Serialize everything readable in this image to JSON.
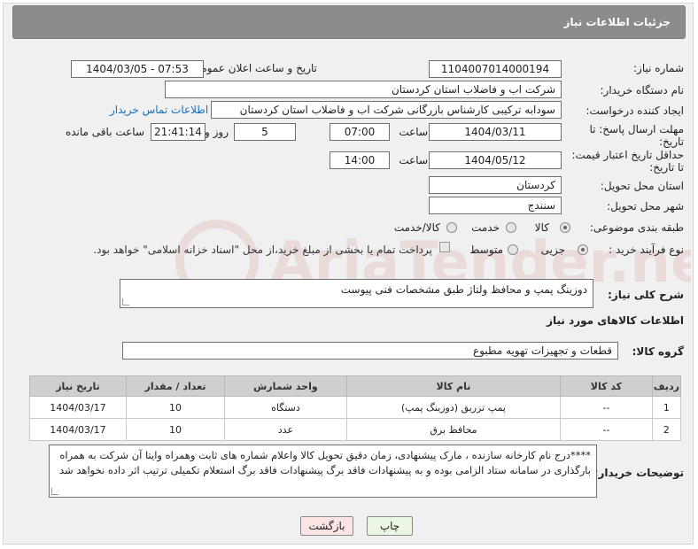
{
  "header": {
    "title": "جزئیات اطلاعات نیاز"
  },
  "form": {
    "need_number_label": "شماره نیاز:",
    "need_number": "1104007014000194",
    "announce_label": "تاریخ و ساعت اعلان عمومی:",
    "announce_value": "1404/03/05 - 07:53",
    "buyer_org_label": "نام دستگاه خریدار:",
    "buyer_org": "شرکت اب و فاضلاب استان کردستان",
    "creator_label": "ایجاد کننده درخواست:",
    "creator": "سودابه ترکیبی کارشناس بازرگانی شرکت اب و فاضلاب استان کردستان",
    "contact_link": "اطلاعات تماس خریدار",
    "reply_deadline_label_1": "مهلت ارسال پاسخ: تا",
    "reply_deadline_label_2": "تاریخ:",
    "reply_date": "1404/03/11",
    "time_label": "ساعت",
    "reply_time": "07:00",
    "days_value": "5",
    "days_label": "روز و",
    "remaining_time": "21:41:14",
    "remaining_label": "ساعت باقی مانده",
    "min_validity_label_1": "حداقل تاریخ اعتبار قیمت:",
    "min_validity_label_2": "تا تاریخ:",
    "validity_date": "1404/05/12",
    "validity_time": "14:00",
    "province_label": "استان محل تحویل:",
    "province": "کردستان",
    "city_label": "شهر محل تحویل:",
    "city": "سنندج",
    "category_label": "طبقه بندی موضوعی:",
    "category_options": [
      "کالا",
      "خدمت",
      "کالا/خدمت"
    ],
    "category_selected": "کالا",
    "process_label": "نوع فرآیند خرید :",
    "process_options": [
      "جزیی",
      "متوسط"
    ],
    "process_selected": "جزیی",
    "payment_note": "پرداخت تمام یا بخشی از مبلغ خرید،از محل \"اسناد خزانه اسلامی\" خواهد بود."
  },
  "description": {
    "label": "شرح کلی نیاز:",
    "text": "دوزینگ پمپ  و محافظ ولتاژ طبق مشخصات فنی پیوست"
  },
  "goods_info": {
    "title": "اطلاعات کالاهای مورد نیاز",
    "group_label": "گروه کالا:",
    "group_value": "قطعات و تجهیزات تهویه مطبوع"
  },
  "table": {
    "columns": [
      "ردیف",
      "کد کالا",
      "نام کالا",
      "واحد شمارش",
      "تعداد / مقدار",
      "تاریخ نیاز"
    ],
    "rows": [
      [
        "1",
        "--",
        "پمپ تزریق (دوزینگ پمپ)",
        "دستگاه",
        "10",
        "1404/03/17"
      ],
      [
        "2",
        "--",
        "محافظ برق",
        "عدد",
        "10",
        "1404/03/17"
      ]
    ]
  },
  "buyer_notes": {
    "label": "توضیحات خریدار:",
    "text": "****درج نام کارخانه سازنده ، مارک پیشنهادی، زمان دقیق تحویل کالا واعلام شماره های ثابت وهمراه وایتا آن شرکت به همراه بارگذاری در سامانه ستاد الزامی بوده و به پیشنهادات فاقد برگ پیشنهادات فاقد برگ استعلام تکمیلی ترتیب اثر داده نخواهد شد"
  },
  "buttons": {
    "print": "چاپ",
    "back": "بازگشت"
  },
  "colors": {
    "header_bg": "#8c8c8c",
    "link": "#1a6fb5",
    "print_bg": "#eaf6e2",
    "back_bg": "#fbe4e4"
  }
}
